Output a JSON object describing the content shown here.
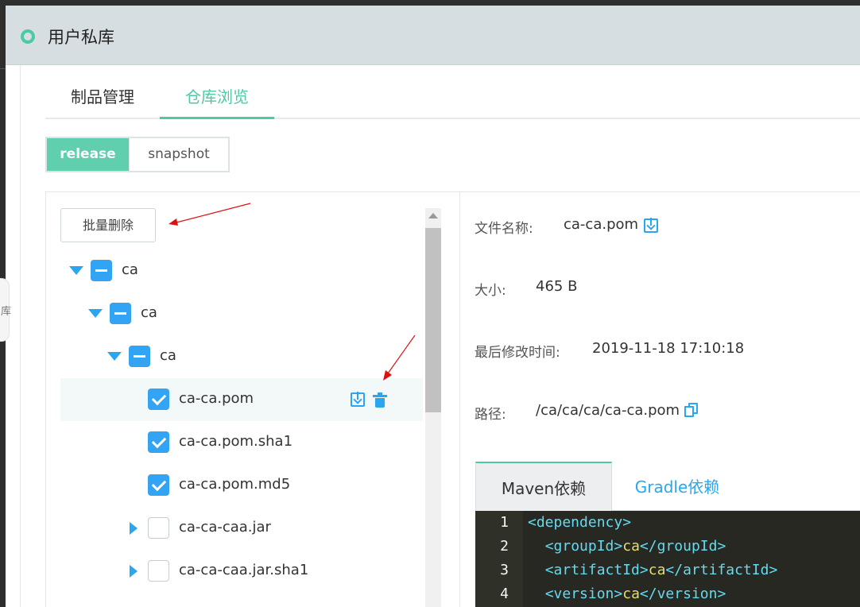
{
  "header": {
    "title": "用户私库"
  },
  "side_handle": {
    "text": "库"
  },
  "tabs": [
    {
      "label": "制品管理",
      "active": false
    },
    {
      "label": "仓库浏览",
      "active": true
    }
  ],
  "repo_switch": {
    "release": "release",
    "snapshot": "snapshot",
    "selected": "release"
  },
  "tree": {
    "batch_delete": "批量删除",
    "nodes": [
      {
        "label": "ca",
        "expanded": true,
        "state": "indeterminate"
      },
      {
        "label": "ca",
        "expanded": true,
        "state": "indeterminate"
      },
      {
        "label": "ca",
        "expanded": true,
        "state": "indeterminate"
      },
      {
        "label": "ca-ca.pom",
        "state": "checked",
        "selected": true
      },
      {
        "label": "ca-ca.pom.sha1",
        "state": "checked"
      },
      {
        "label": "ca-ca.pom.md5",
        "state": "checked"
      },
      {
        "label": "ca-ca-caa.jar",
        "expanded": false,
        "state": "unchecked"
      },
      {
        "label": "ca-ca-caa.jar.sha1",
        "expanded": false,
        "state": "unchecked"
      }
    ]
  },
  "details": {
    "filename_label": "文件名称:",
    "filename_value": "ca-ca.pom",
    "size_label": "大小:",
    "size_value": "465 B",
    "modified_label": "最后修改时间:",
    "modified_value": "2019-11-18 17:10:18",
    "path_label": "路径:",
    "path_value": "/ca/ca/ca/ca-ca.pom"
  },
  "dependency": {
    "tabs": [
      {
        "label": "Maven依赖",
        "active": true
      },
      {
        "label": "Gradle依赖",
        "active": false
      }
    ],
    "lines": [
      {
        "num": "1",
        "tag_open": "<dependency>",
        "value": "",
        "tag_close": ""
      },
      {
        "num": "2",
        "tag_open": "<groupId>",
        "value": "ca",
        "tag_close": "</groupId>"
      },
      {
        "num": "3",
        "tag_open": "<artifactId>",
        "value": "ca",
        "tag_close": "</artifactId>"
      },
      {
        "num": "4",
        "tag_open": "<version>",
        "value": "ca",
        "tag_close": "</version>"
      }
    ]
  },
  "colors": {
    "accent": "#4ec9a6",
    "link_blue": "#2aa6f0",
    "checkbox_blue": "#33a3f4",
    "annotation_arrow": "#e01010"
  }
}
